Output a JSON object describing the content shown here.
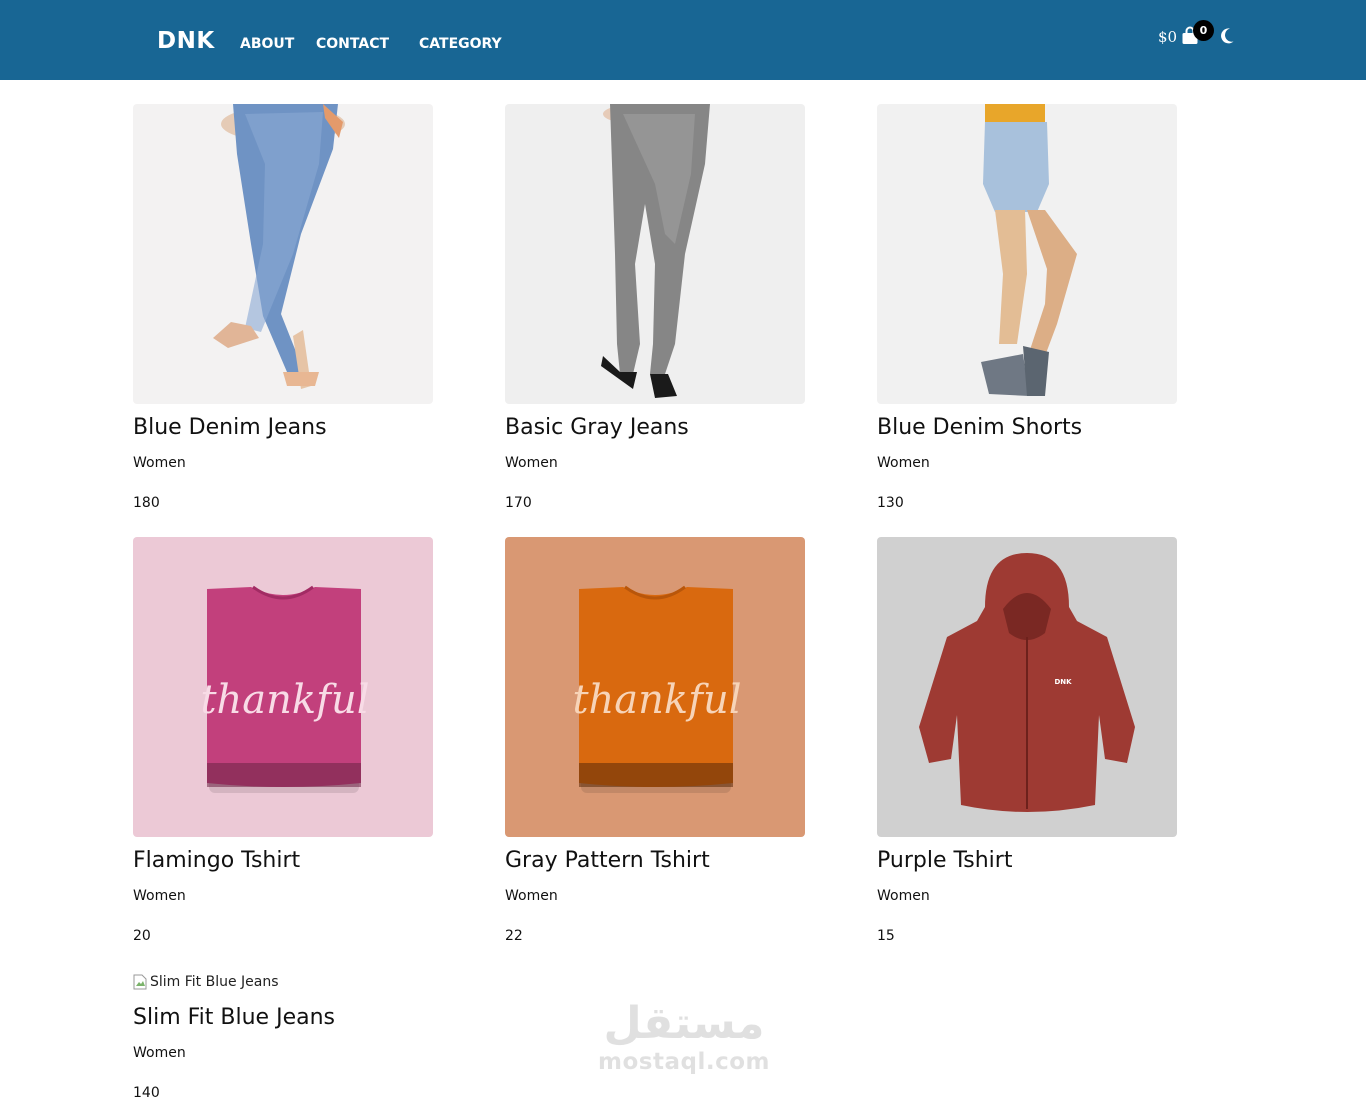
{
  "brand": "DNK",
  "nav": {
    "about": "ABOUT",
    "contact": "CONTACT",
    "category": "CATEGORY"
  },
  "cart": {
    "total": "$0",
    "count": "0",
    "icon": "shopping-bag-icon"
  },
  "theme_toggle": {
    "icon": "moon-icon"
  },
  "products": [
    {
      "title": "Blue Denim Jeans",
      "category": "Women",
      "price": "180",
      "image": "blue-denim-jeans-photo"
    },
    {
      "title": "Basic Gray Jeans",
      "category": "Women",
      "price": "170",
      "image": "gray-jeans-photo"
    },
    {
      "title": "Blue Denim Shorts",
      "category": "Women",
      "price": "130",
      "image": "denim-shorts-photo"
    },
    {
      "title": "Flamingo Tshirt",
      "category": "Women",
      "price": "20",
      "image": "pink-tshirt-photo",
      "image_text": "thankful"
    },
    {
      "title": "Gray Pattern Tshirt",
      "category": "Women",
      "price": "22",
      "image": "orange-tshirt-photo",
      "image_text": "thankful"
    },
    {
      "title": "Purple Tshirt",
      "category": "Women",
      "price": "15",
      "image": "red-hoodie-photo",
      "image_text": "DNK"
    },
    {
      "title": "Slim Fit Blue Jeans",
      "category": "Women",
      "price": "140",
      "image_alt": "Slim Fit Blue Jeans"
    }
  ],
  "watermark": {
    "mark": "مستقل",
    "url": "mostaql.com"
  },
  "colors": {
    "navbar": "#186694",
    "text": "#111111",
    "background": "#ffffff"
  }
}
